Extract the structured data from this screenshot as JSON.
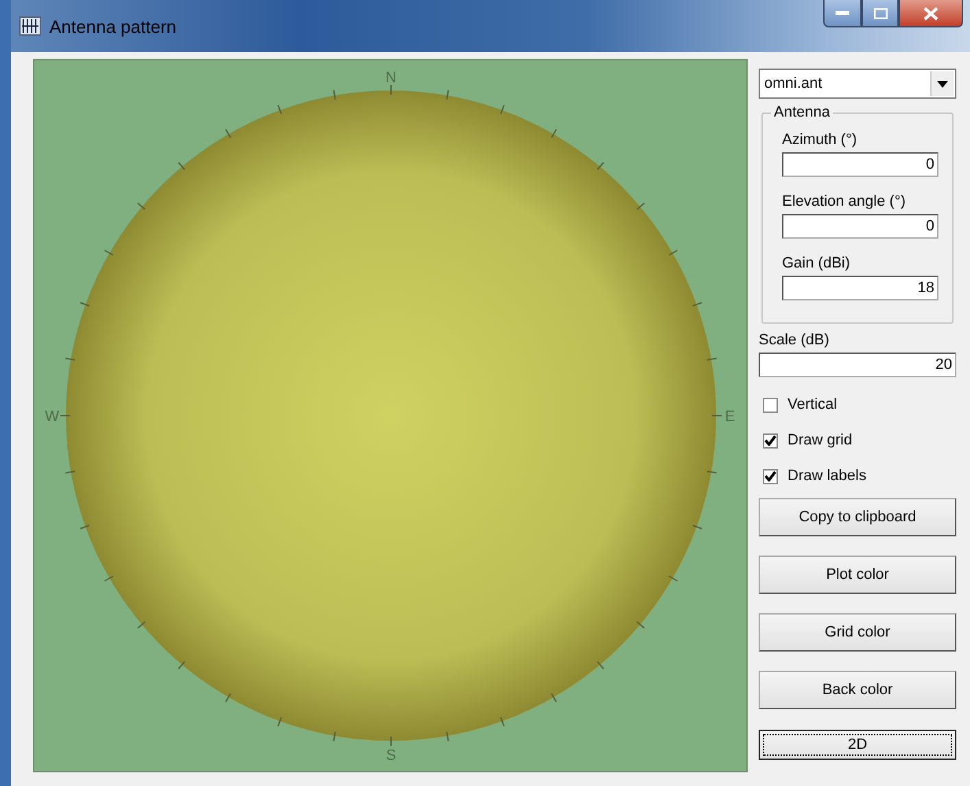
{
  "window": {
    "title": "Antenna pattern"
  },
  "plot": {
    "labels": [
      {
        "text": "N"
      },
      {
        "text": "E"
      },
      {
        "text": "S"
      },
      {
        "text": "W"
      }
    ]
  },
  "file_select": {
    "value": "omni.ant"
  },
  "antenna": {
    "title": "Antenna",
    "fields": [
      {
        "label": "Azimuth (°)",
        "value": "0"
      },
      {
        "label": "Elevation angle (°)",
        "value": "0"
      },
      {
        "label": "Gain (dBi)",
        "value": "18"
      }
    ]
  },
  "scale": {
    "label": "Scale (dB)",
    "value": "20"
  },
  "options": [
    {
      "label": "Vertical",
      "checked": false
    },
    {
      "label": "Draw grid",
      "checked": true
    },
    {
      "label": "Draw labels",
      "checked": true
    }
  ],
  "buttons": [
    {
      "label": "Copy to clipboard",
      "focused": false
    },
    {
      "label": "Plot color",
      "focused": false
    },
    {
      "label": "Grid color",
      "focused": false
    },
    {
      "label": "Back color",
      "focused": false
    },
    {
      "label": "2D",
      "focused": true
    }
  ]
}
